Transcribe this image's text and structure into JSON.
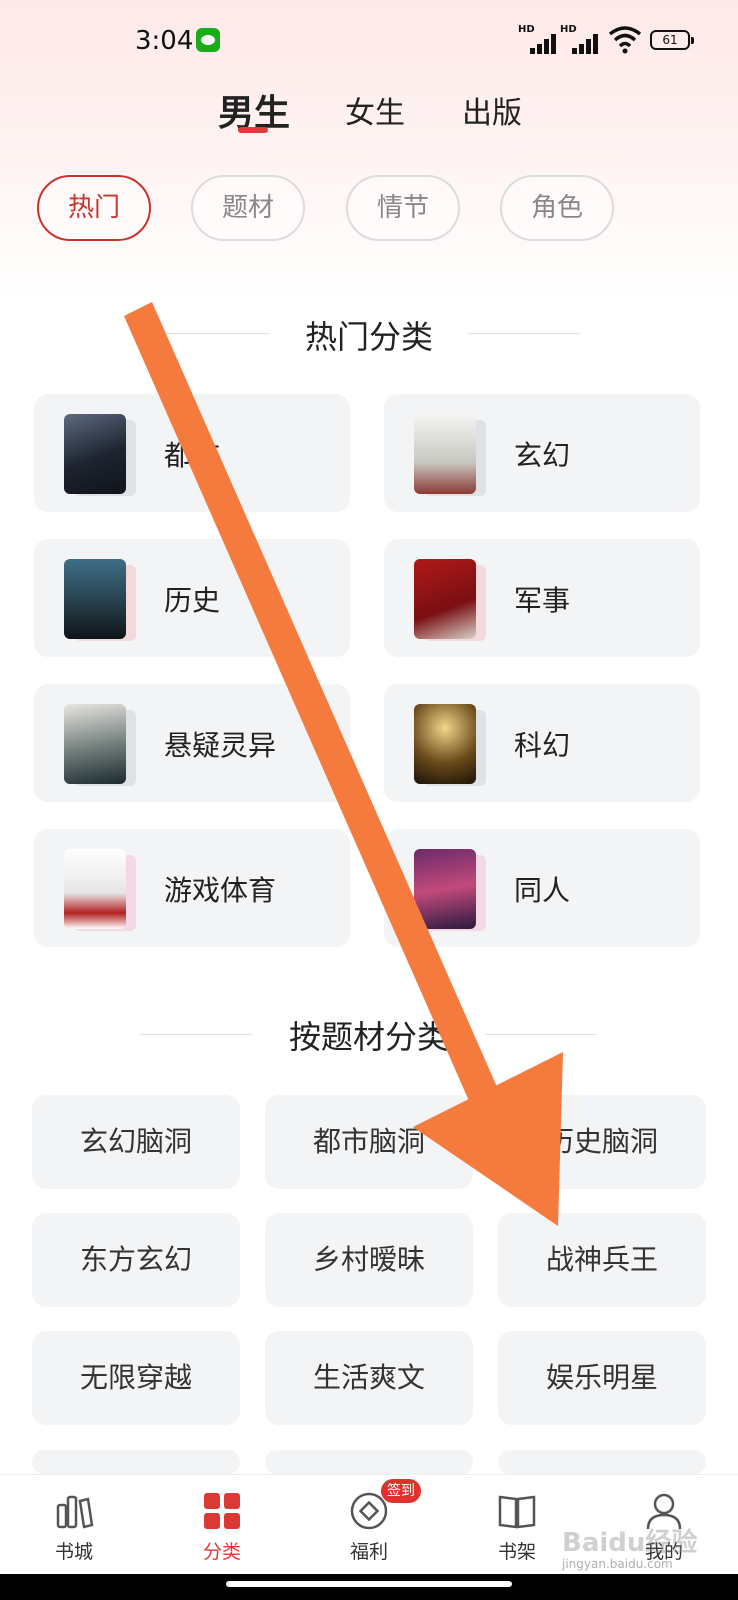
{
  "status_bar": {
    "time": "3:04",
    "network_a": "HD",
    "network_b": "HD",
    "battery": "61"
  },
  "gender_tabs": [
    {
      "label": "男生",
      "active": true
    },
    {
      "label": "女生",
      "active": false
    },
    {
      "label": "出版",
      "active": false
    }
  ],
  "filters": [
    "热门",
    "题材",
    "情节",
    "角色"
  ],
  "hot_section": {
    "title": "热门分类",
    "items": [
      {
        "label": "都市"
      },
      {
        "label": "玄幻"
      },
      {
        "label": "历史"
      },
      {
        "label": "军事"
      },
      {
        "label": "悬疑灵异"
      },
      {
        "label": "科幻"
      },
      {
        "label": "游戏体育"
      },
      {
        "label": "同人"
      }
    ]
  },
  "theme_section": {
    "title": "按题材分类",
    "items": [
      "玄幻脑洞",
      "都市脑洞",
      "历史脑洞",
      "东方玄幻",
      "乡村暧昧",
      "战神兵王",
      "无限穿越",
      "生活爽文",
      "娱乐明星"
    ]
  },
  "bottom_nav": [
    {
      "label": "书城",
      "icon": "bookstore-icon"
    },
    {
      "label": "分类",
      "icon": "category-grid-icon",
      "active": true
    },
    {
      "label": "福利",
      "icon": "coin-icon",
      "badge": "签到"
    },
    {
      "label": "书架",
      "icon": "bookshelf-icon"
    },
    {
      "label": "我的",
      "icon": "profile-icon"
    }
  ],
  "watermark": {
    "main": "Baidu经验",
    "sub": "jingyan.baidu.com"
  },
  "colors": {
    "accent": "#d93a33",
    "arrow": "#f47a3e",
    "card_bg": "#f3f4f6"
  }
}
